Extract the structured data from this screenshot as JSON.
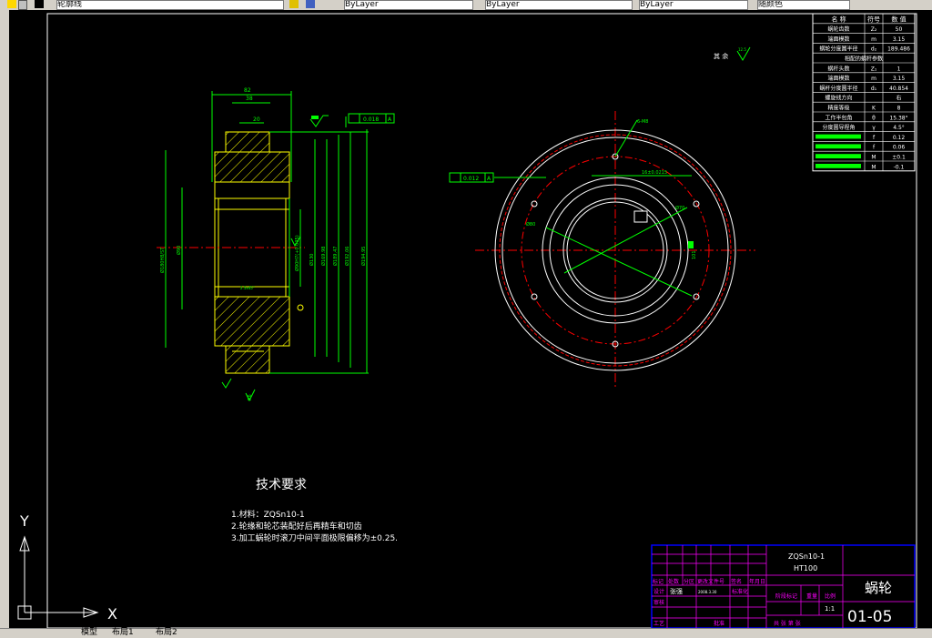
{
  "toolbar": {
    "layer_field": "轮廓线",
    "color_field": "ByLayer",
    "linetype_field": "ByLayer",
    "lineweight_field": "ByLayer",
    "plotstyle_field": "随颜色"
  },
  "drawing": {
    "dims": {
      "d82": "82",
      "d38": "38",
      "d20": "20",
      "tol_top": "0.018",
      "tol_top_ref": "A",
      "left1": "Ø180H8/ST",
      "left2": "Ø90",
      "mid1": "Ø90H7(+0.035)",
      "mid2": "Ø130",
      "mid3": "Ø169.98",
      "mid4": "Ø189.47",
      "mid5": "Ø192.06",
      "mid6": "Ø194.95",
      "chamfer": "2.5x45°",
      "radius": "R6",
      "tol_left": "0.012",
      "tol_left_ref": "A",
      "holes": "6-M8",
      "key_width": "16±0.0215",
      "hole_circle": "Ø70",
      "bolt_circle": "Ø80",
      "key_depth": "101",
      "rest": "其 余",
      "rest_rough": "12.5"
    },
    "tech": {
      "title": "技术要求",
      "line1": "1.材料：ZQSn10-1",
      "line2": "2.轮缘和轮芯装配好后再精车和切齿",
      "line3": "3.加工蜗轮时滚刀中间平面极限偏移为±0.25."
    },
    "param_table": {
      "headers": [
        "名  称",
        "符号",
        "数 值"
      ],
      "rows": [
        [
          "蜗轮齿数",
          "Z₂",
          "50"
        ],
        [
          "端面模数",
          "m",
          "3.15"
        ],
        [
          "蜗轮分度圆半径",
          "d₂",
          "189.486"
        ],
        [
          "相配的蜗杆参数",
          "",
          ""
        ],
        [
          "蜗杆头数",
          "Z₁",
          "1"
        ],
        [
          "端面模数",
          "m",
          "3.15"
        ],
        [
          "蜗杆分度圆半径",
          "d₁",
          "40.854"
        ],
        [
          "螺旋线方向",
          "",
          "右"
        ],
        [
          "精度等级",
          "K",
          "8"
        ],
        [
          "工作半包角",
          "θ",
          "15.38°"
        ],
        [
          "分度圆导程角",
          "γ",
          "4.5°"
        ],
        [
          "",
          "f",
          "0.12"
        ],
        [
          "",
          "f",
          "0.06"
        ],
        [
          "",
          "M",
          "±0.1"
        ],
        [
          "",
          "M",
          "-0.1"
        ]
      ]
    },
    "title_block": {
      "material": "ZQSn10-1",
      "material2": "HT100",
      "name": "蜗轮",
      "code": "01-05",
      "scale": "1:1",
      "labels": [
        "标记",
        "处数",
        "分区",
        "更改文件号",
        "签名",
        "年月日"
      ],
      "designer_label": "设计",
      "designer": "张强",
      "date": "2008.3.30",
      "std_label": "标准化",
      "check_label": "审核",
      "craft_label": "工艺",
      "approve_label": "批准",
      "stage_label": "阶段标记",
      "weight_label": "重量",
      "ratio_label": "比例",
      "sheets": "共  张  第  张"
    },
    "ucs": {
      "y": "Y",
      "x": "X"
    }
  },
  "status": {
    "tabs": [
      "模型",
      "布局1",
      "布局2"
    ]
  },
  "colors": {
    "background": "#000000",
    "outline": "#ffff00",
    "dimension": "#00ff00",
    "hatch": "#ffff00",
    "center": "#ff0000",
    "text": "#ffffff",
    "table_line": "#ff00ff",
    "table_border": "#0000ff"
  }
}
